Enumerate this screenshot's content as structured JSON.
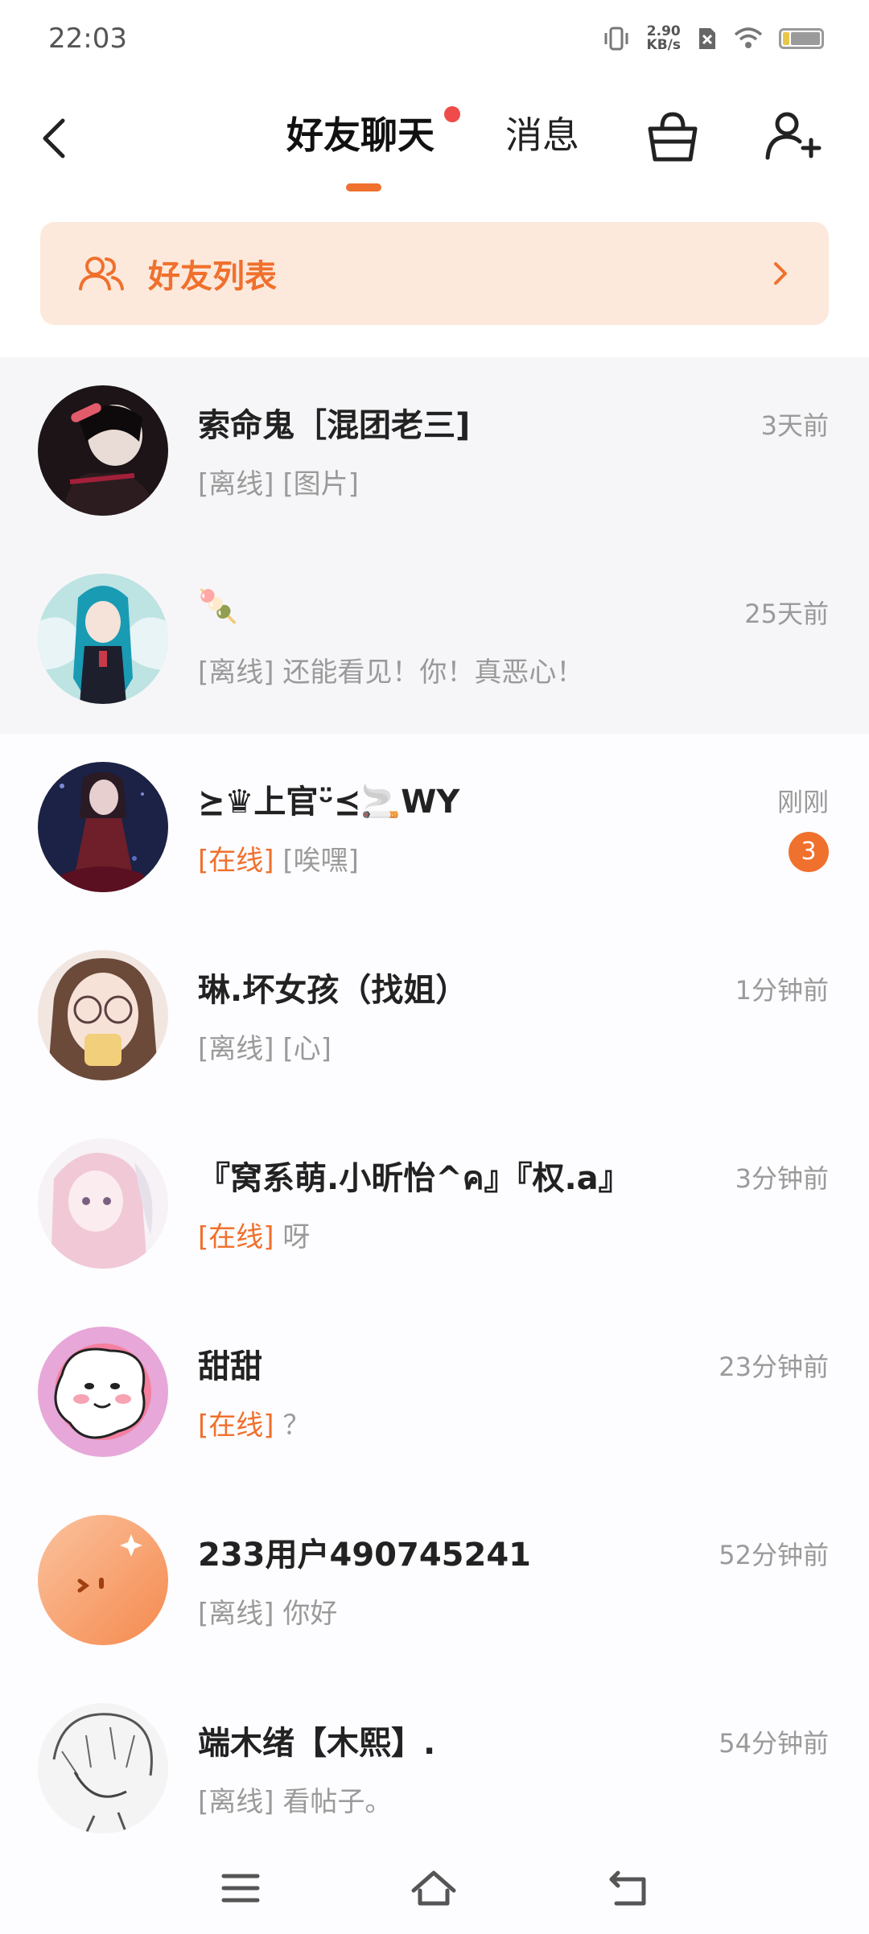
{
  "status_bar": {
    "time": "22:03",
    "net_speed_value": "2.90",
    "net_speed_unit": "KB/s"
  },
  "header": {
    "tabs": [
      {
        "label": "好友聊天"
      },
      {
        "label": "消息"
      }
    ]
  },
  "friend_list_bar": {
    "label": "好友列表"
  },
  "chats": [
    {
      "name": "索命鬼［混团老三]",
      "status": "[离线]",
      "message": "[图片]",
      "time": "3天前",
      "online": false,
      "pinned": true
    },
    {
      "name": "🍡",
      "status": "[离线]",
      "message": "还能看见！你！真恶心！",
      "time": "25天前",
      "online": false,
      "pinned": true
    },
    {
      "name": "⪰♛上官ᵕ̈⪯🚬WY",
      "status": "[在线]",
      "message": "[唉嘿]",
      "time": "刚刚",
      "online": true,
      "unread": "3"
    },
    {
      "name": "琳.坏女孩（找姐）",
      "status": "[离线]",
      "message": "[心]",
      "time": "1分钟前",
      "online": false
    },
    {
      "name": "『窝系萌.小昕怡^ค』『权.a』",
      "status": "[在线]",
      "message": "呀",
      "time": "3分钟前",
      "online": true
    },
    {
      "name": "甜甜",
      "status": "[在线]",
      "message": "？",
      "time": "23分钟前",
      "online": true
    },
    {
      "name": "233用户490745241",
      "status": "[离线]",
      "message": "你好",
      "time": "52分钟前",
      "online": false
    },
    {
      "name": "端木绪【木熙】.",
      "status": "[离线]",
      "message": "看帖子。",
      "time": "54分钟前",
      "online": false
    }
  ],
  "colors": {
    "accent": "#f0702d",
    "friend_list_bg": "#fde9dc",
    "badge_dot": "#f04b4b",
    "pinned_bg": "#f6f6f8",
    "muted_text": "#9a9a9a"
  },
  "icons": {
    "back": "chevron-left-icon",
    "basket": "basket-icon",
    "add_user": "add-user-icon",
    "friends": "friends-icon",
    "menu": "menu-icon",
    "home": "home-icon",
    "return": "back-return-icon"
  }
}
